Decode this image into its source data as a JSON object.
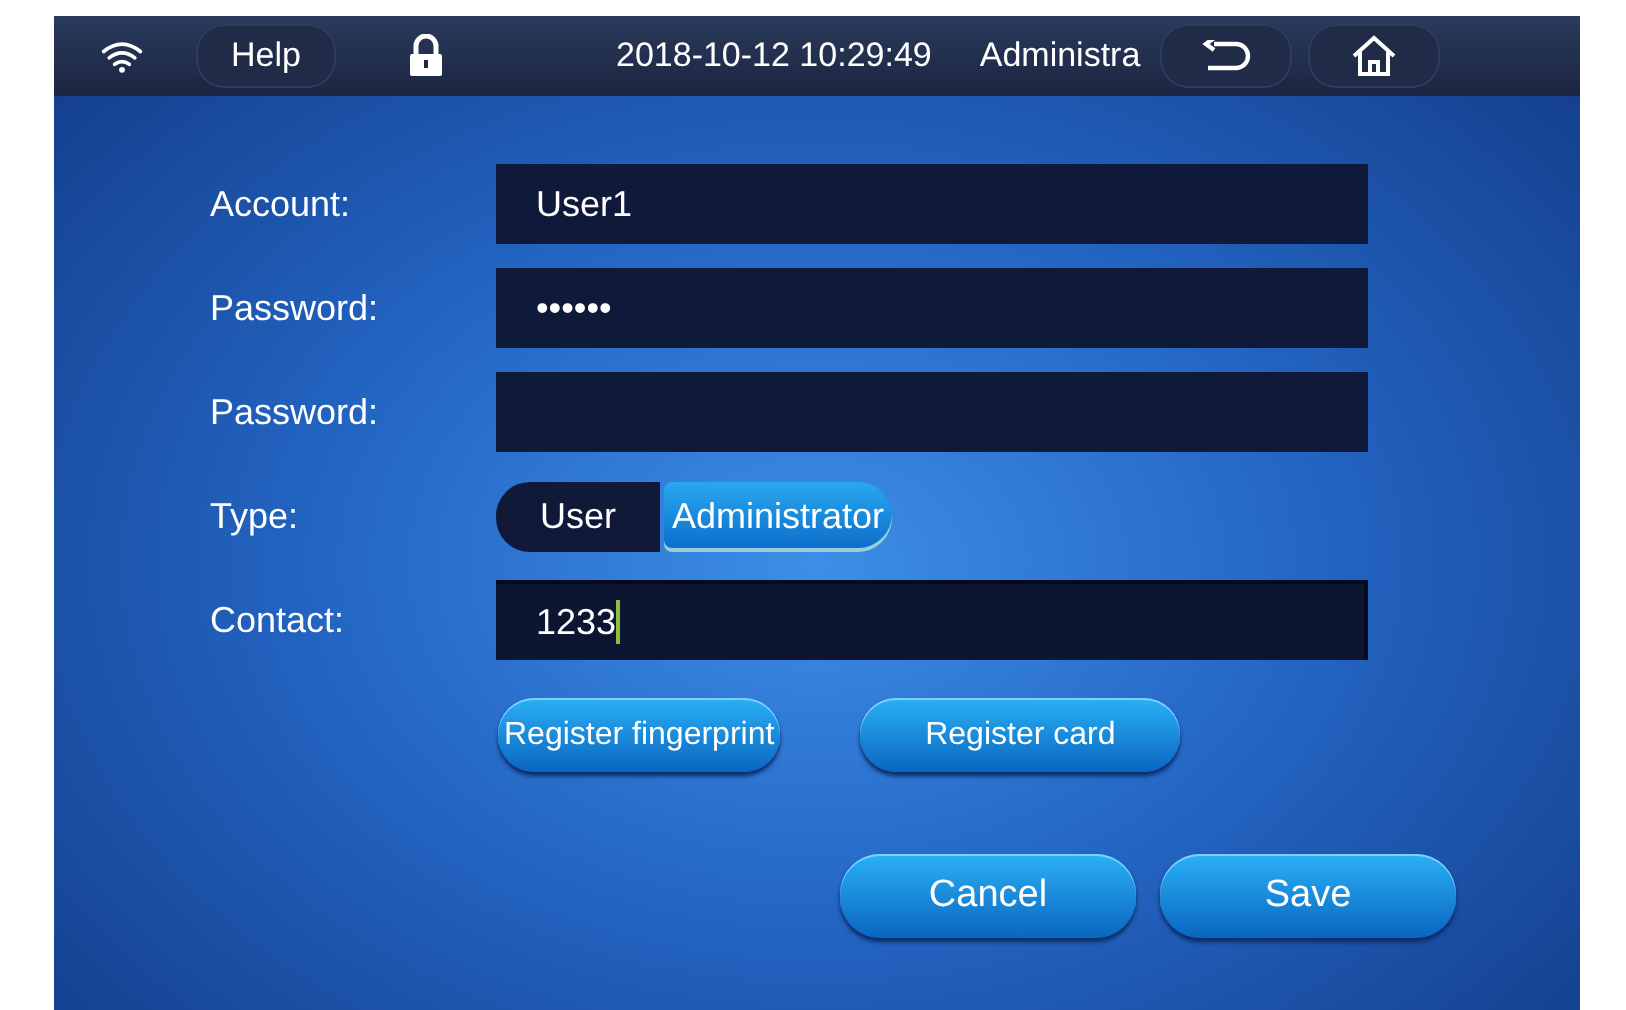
{
  "status_bar": {
    "help": "Help",
    "datetime": "2018-10-12 10:29:49",
    "user": "Administra"
  },
  "form": [
    {
      "kind": "text",
      "label": "Account:",
      "value": "User1",
      "focused": false
    },
    {
      "kind": "text",
      "label": "Password:",
      "value": "••••••",
      "focused": false
    },
    {
      "kind": "text",
      "label": "Password:",
      "focused": false
    },
    {
      "kind": "choice",
      "label": "Type:",
      "options": [
        {
          "label": "User",
          "selected": false
        },
        {
          "label": "Administrator",
          "selected": true
        }
      ]
    },
    {
      "kind": "text",
      "label": "Contact:",
      "value": "1233",
      "focused": true
    }
  ],
  "register_buttons": [
    "Register fingerprint",
    "Register card"
  ],
  "action_buttons": [
    "Cancel",
    "Save"
  ]
}
